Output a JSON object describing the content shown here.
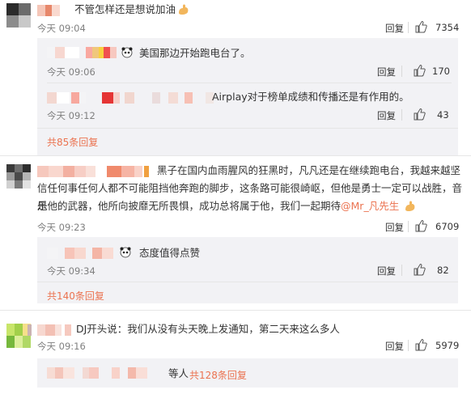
{
  "comments": [
    {
      "text": "不管怎样还是想说加油",
      "time": "今天 09:04",
      "reply_label": "回复",
      "likes": "7354"
    },
    {
      "text": "黑子在国内血雨腥风的狂黑时，凡凡还是在继续跑电台，我越来越坚",
      "text2": "信任何事任何人都不可能阻挡他奔跑的脚步，这条路可能很崎岖，但他是勇士一定可以战胜，音乐",
      "text3": "是他的武器，他所向披靡无所畏惧，成功总将属于他，我们一起期待",
      "mention": "@Mr_凡先生",
      "time": "今天 09:23",
      "reply_label": "回复",
      "likes": "6709"
    },
    {
      "text": "DJ开头说：我们从没有头天晚上发通知，第二天来这么多人",
      "time": "今天 09:16",
      "reply_label": "回复",
      "likes": "5979"
    }
  ],
  "replies": [
    {
      "text": "美国那边开始跑电台了。",
      "time": "今天 09:06",
      "reply_label": "回复",
      "likes": "170"
    },
    {
      "text": "Airplay对于榜单成绩和传播还是有作用的。",
      "time": "今天 09:12",
      "reply_label": "回复",
      "likes": "43"
    },
    {
      "text": "态度值得点赞",
      "time": "今天 09:34",
      "reply_label": "回复",
      "likes": "82"
    }
  ],
  "more_links": [
    "共85条回复",
    "共140条回复"
  ],
  "collapsed_thread": {
    "suffix": "等人",
    "link": "共128条回复"
  },
  "colors": {
    "link": "#eb7350",
    "subbox": "#f2f2f5",
    "muted": "#808080"
  },
  "icons": [
    "thumb-up-icon",
    "flexed-arm-emoji",
    "panda-emoji"
  ]
}
